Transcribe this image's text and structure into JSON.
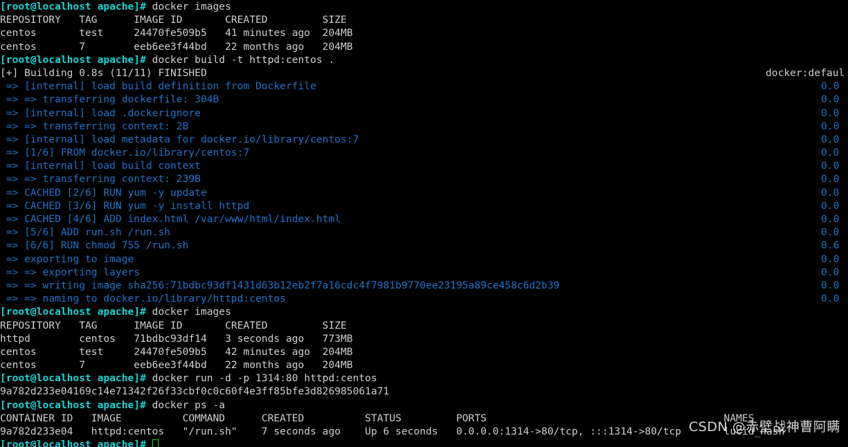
{
  "terminal": {
    "prompt": "[root@localhost apache]#",
    "cursor": "block-cursor",
    "colors": {
      "background": "#000000",
      "foreground": "#d0d0d0",
      "prompt": "#14d5d5",
      "build_step": "#2472c8",
      "cursor": "#1fd21f"
    },
    "watermark": "CSDN @赤壁战神曹阿瞒",
    "right_header": "docker:defaul"
  },
  "lines": [
    {
      "type": "prompt",
      "command": " docker images"
    },
    {
      "type": "plain",
      "text": "REPOSITORY   TAG      IMAGE ID       CREATED         SIZE"
    },
    {
      "type": "plain",
      "text": "centos       test     24470fe509b5   41 minutes ago  204MB"
    },
    {
      "type": "plain",
      "text": "centos       7        eeb6ee3f44bd   22 months ago   204MB"
    },
    {
      "type": "prompt",
      "command": " docker build -t httpd:centos ."
    },
    {
      "type": "plain",
      "text": "[+] Building 0.8s (11/11) FINISHED",
      "right": "docker:defaul"
    },
    {
      "type": "step",
      "text": " => [internal] load build definition from Dockerfile",
      "timing": "0.0"
    },
    {
      "type": "step",
      "text": " => => transferring dockerfile: 304B",
      "timing": "0.0"
    },
    {
      "type": "step",
      "text": " => [internal] load .dockerignore",
      "timing": "0.0"
    },
    {
      "type": "step",
      "text": " => => transferring context: 2B",
      "timing": "0.0"
    },
    {
      "type": "step",
      "text": " => [internal] load metadata for docker.io/library/centos:7",
      "timing": "0.0"
    },
    {
      "type": "step",
      "text": " => [1/6] FROM docker.io/library/centos:7",
      "timing": "0.0"
    },
    {
      "type": "step",
      "text": " => [internal] load build context",
      "timing": "0.0"
    },
    {
      "type": "step",
      "text": " => => transferring context: 239B",
      "timing": "0.0"
    },
    {
      "type": "step",
      "text": " => CACHED [2/6] RUN yum -y update",
      "timing": "0.0"
    },
    {
      "type": "step",
      "text": " => CACHED [3/6] RUN yum -y install httpd",
      "timing": "0.0"
    },
    {
      "type": "step",
      "text": " => CACHED [4/6] ADD index.html /var/www/html/index.html",
      "timing": "0.0"
    },
    {
      "type": "step",
      "text": " => [5/6] ADD run.sh /run.sh",
      "timing": "0.0"
    },
    {
      "type": "step",
      "text": " => [6/6] RUN chmod 755 /run.sh",
      "timing": "0.6"
    },
    {
      "type": "step",
      "text": " => exporting to image",
      "timing": "0.0"
    },
    {
      "type": "step",
      "text": " => => exporting layers",
      "timing": "0.0"
    },
    {
      "type": "step",
      "text": " => => writing image sha256:71bdbc93df1431d63b12eb2f7a16cdc4f7981b9770ee23195a89ce458c6d2b39",
      "timing": "0.0"
    },
    {
      "type": "step",
      "text": " => => naming to docker.io/library/httpd:centos",
      "timing": "0.0"
    },
    {
      "type": "prompt",
      "command": " docker images"
    },
    {
      "type": "plain",
      "text": "REPOSITORY   TAG      IMAGE ID       CREATED         SIZE"
    },
    {
      "type": "plain",
      "text": "httpd        centos   71bdbc93df14   3 seconds ago   773MB"
    },
    {
      "type": "plain",
      "text": "centos       test     24470fe509b5   42 minutes ago  204MB"
    },
    {
      "type": "plain",
      "text": "centos       7        eeb6ee3f44bd   22 months ago   204MB"
    },
    {
      "type": "prompt",
      "command": " docker run -d -p 1314:80 httpd:centos"
    },
    {
      "type": "plain",
      "text": "9a782d233e04169c14e71342f26f33cbf0c0c60f4e3ff85bfe3d826985061a71"
    },
    {
      "type": "prompt",
      "command": " docker ps -a"
    },
    {
      "type": "plain",
      "text": "CONTAINER ID   IMAGE          COMMAND      CREATED          STATUS         PORTS                                       NAMES"
    },
    {
      "type": "plain",
      "text": "9a782d233e04   httpd:centos   \"/run.sh\"    7 seconds ago    Up 6 seconds   0.0.0.0:1314->80/tcp, :::1314->80/tcp       lucid_nash"
    },
    {
      "type": "prompt-cursor",
      "command": " "
    }
  ],
  "docker_images_first": {
    "headers": [
      "REPOSITORY",
      "TAG",
      "IMAGE ID",
      "CREATED",
      "SIZE"
    ],
    "rows": [
      [
        "centos",
        "test",
        "24470fe509b5",
        "41 minutes ago",
        "204MB"
      ],
      [
        "centos",
        "7",
        "eeb6ee3f44bd",
        "22 months ago",
        "204MB"
      ]
    ]
  },
  "docker_images_second": {
    "headers": [
      "REPOSITORY",
      "TAG",
      "IMAGE ID",
      "CREATED",
      "SIZE"
    ],
    "rows": [
      [
        "httpd",
        "centos",
        "71bdbc93df14",
        "3 seconds ago",
        "773MB"
      ],
      [
        "centos",
        "test",
        "24470fe509b5",
        "42 minutes ago",
        "204MB"
      ],
      [
        "centos",
        "7",
        "eeb6ee3f44bd",
        "22 months ago",
        "204MB"
      ]
    ]
  },
  "docker_ps": {
    "headers": [
      "CONTAINER ID",
      "IMAGE",
      "COMMAND",
      "CREATED",
      "STATUS",
      "PORTS",
      "NAMES"
    ],
    "rows": [
      [
        "9a782d233e04",
        "httpd:centos",
        "\"/run.sh\"",
        "7 seconds ago",
        "Up 6 seconds",
        "0.0.0.0:1314->80/tcp, :::1314->80/tcp",
        "lucid_nash"
      ]
    ]
  },
  "build_summary": {
    "status_line": "[+] Building 0.8s (11/11) FINISHED",
    "duration": "0.8s",
    "steps_done": "11/11",
    "state": "FINISHED",
    "builder": "docker:defaul",
    "image_digest": "sha256:71bdbc93df1431d63b12eb2f7a16cdc4f7981b9770ee23195a89ce458c6d2b39",
    "image_name": "docker.io/library/httpd:centos"
  },
  "container": {
    "run_id": "9a782d233e04169c14e71342f26f33cbf0c0c60f4e3ff85bfe3d826985061a71",
    "short_id": "9a782d233e04",
    "name": "lucid_nash",
    "port_mapping": "0.0.0.0:1314->80/tcp, :::1314->80/tcp"
  }
}
